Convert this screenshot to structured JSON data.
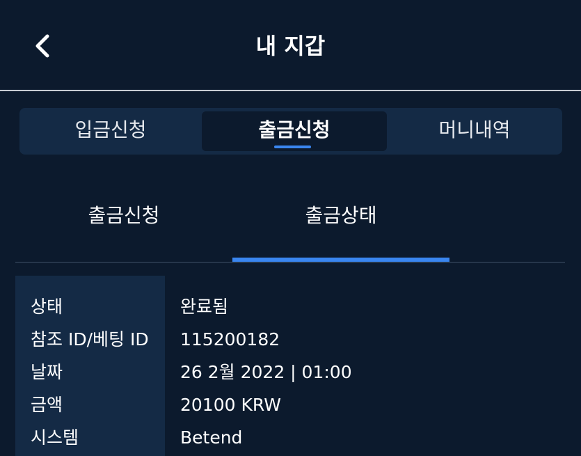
{
  "header": {
    "title": "내 지갑",
    "back_icon": "chevron-left-icon"
  },
  "main_tabs": [
    {
      "label": "입금신청",
      "active": false
    },
    {
      "label": "출금신청",
      "active": true
    },
    {
      "label": "머니내역",
      "active": false
    }
  ],
  "sub_tabs": [
    {
      "label": "출금신청",
      "active": false
    },
    {
      "label": "출금상태",
      "active": true
    }
  ],
  "details": [
    {
      "label": "상태",
      "value": "완료됨"
    },
    {
      "label": "참조 ID/베팅 ID",
      "value": "115200182"
    },
    {
      "label": "날짜",
      "value": "26 2월 2022 | 01:00"
    },
    {
      "label": "금액",
      "value": "20100 KRW"
    },
    {
      "label": "시스템",
      "value": "Betend"
    }
  ],
  "colors": {
    "background": "#0c1a2d",
    "panel": "#142a45",
    "accent": "#3a86f0",
    "divider": "#c8ccd2"
  }
}
